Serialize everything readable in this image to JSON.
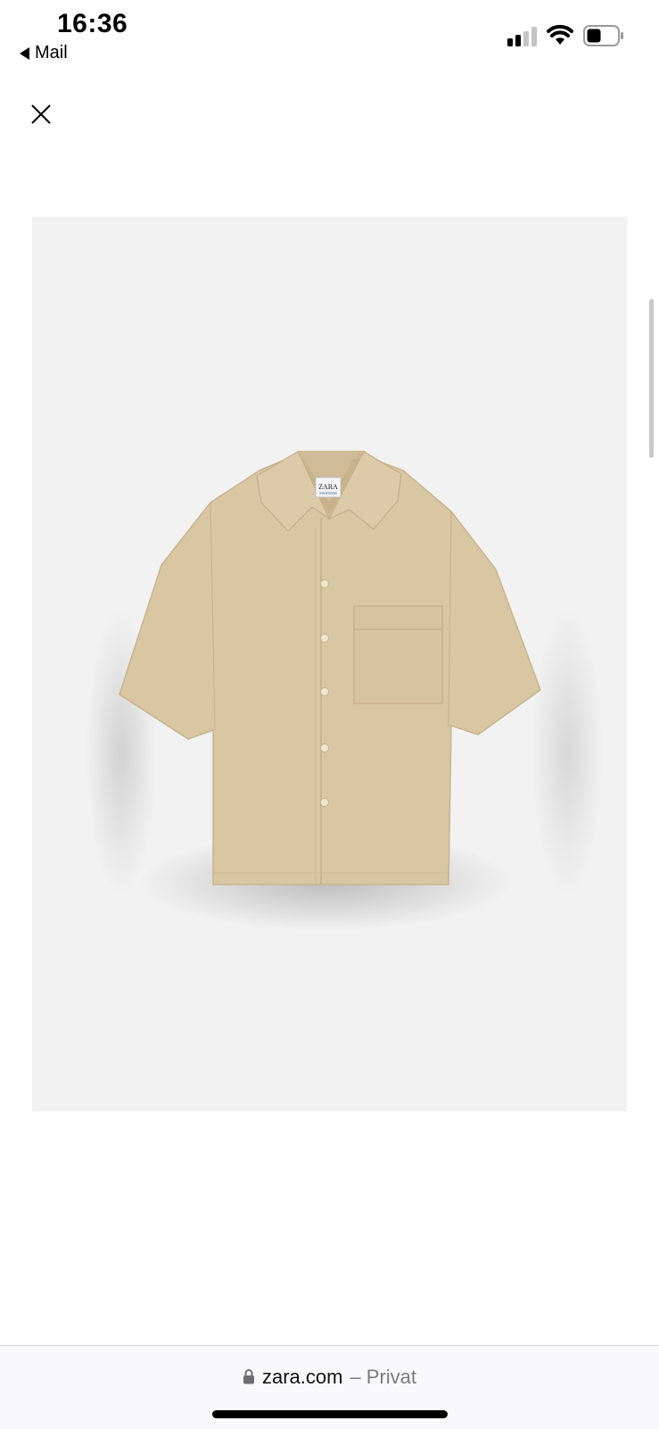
{
  "status_bar": {
    "time": "16:36",
    "back_app_label": "Mail",
    "signal_bars_active": 2,
    "signal_bars_total": 4,
    "battery_level": 0.4
  },
  "viewer": {
    "close_icon": "close-icon",
    "product_image": {
      "subject": "short-sleeve camp-collar linen shirt",
      "garment_color": "#d9c6a3",
      "background_color": "#f2f2f2",
      "label_text": "ZARA"
    }
  },
  "browser": {
    "domain": "zara.com",
    "suffix": "– Privat",
    "lock_icon": "lock-icon"
  },
  "colors": {
    "page_background": "#ffffff",
    "bottom_bar_background": "#f9f9fb",
    "url_secondary": "#7a7a80"
  }
}
